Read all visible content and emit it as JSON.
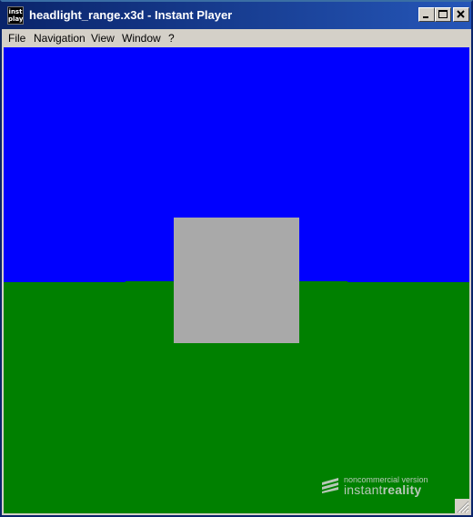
{
  "window": {
    "title": "headlight_range.x3d - Instant Player",
    "icon_text_top": "inst",
    "icon_text_bottom": "play",
    "buttons": [
      "minimize-icon",
      "maximize-icon",
      "close-icon"
    ]
  },
  "menu": {
    "items": [
      {
        "label": "File"
      },
      {
        "label": "Navigation"
      },
      {
        "label": "View"
      },
      {
        "label": "Window"
      },
      {
        "label": "?"
      }
    ]
  },
  "scene": {
    "sky_color": "#0000ff",
    "ground_color": "#008000",
    "box_color": "#a9a9a9"
  },
  "watermark": {
    "small_text": "noncommercial version",
    "brand_light": "instant",
    "brand_bold": "reality"
  }
}
